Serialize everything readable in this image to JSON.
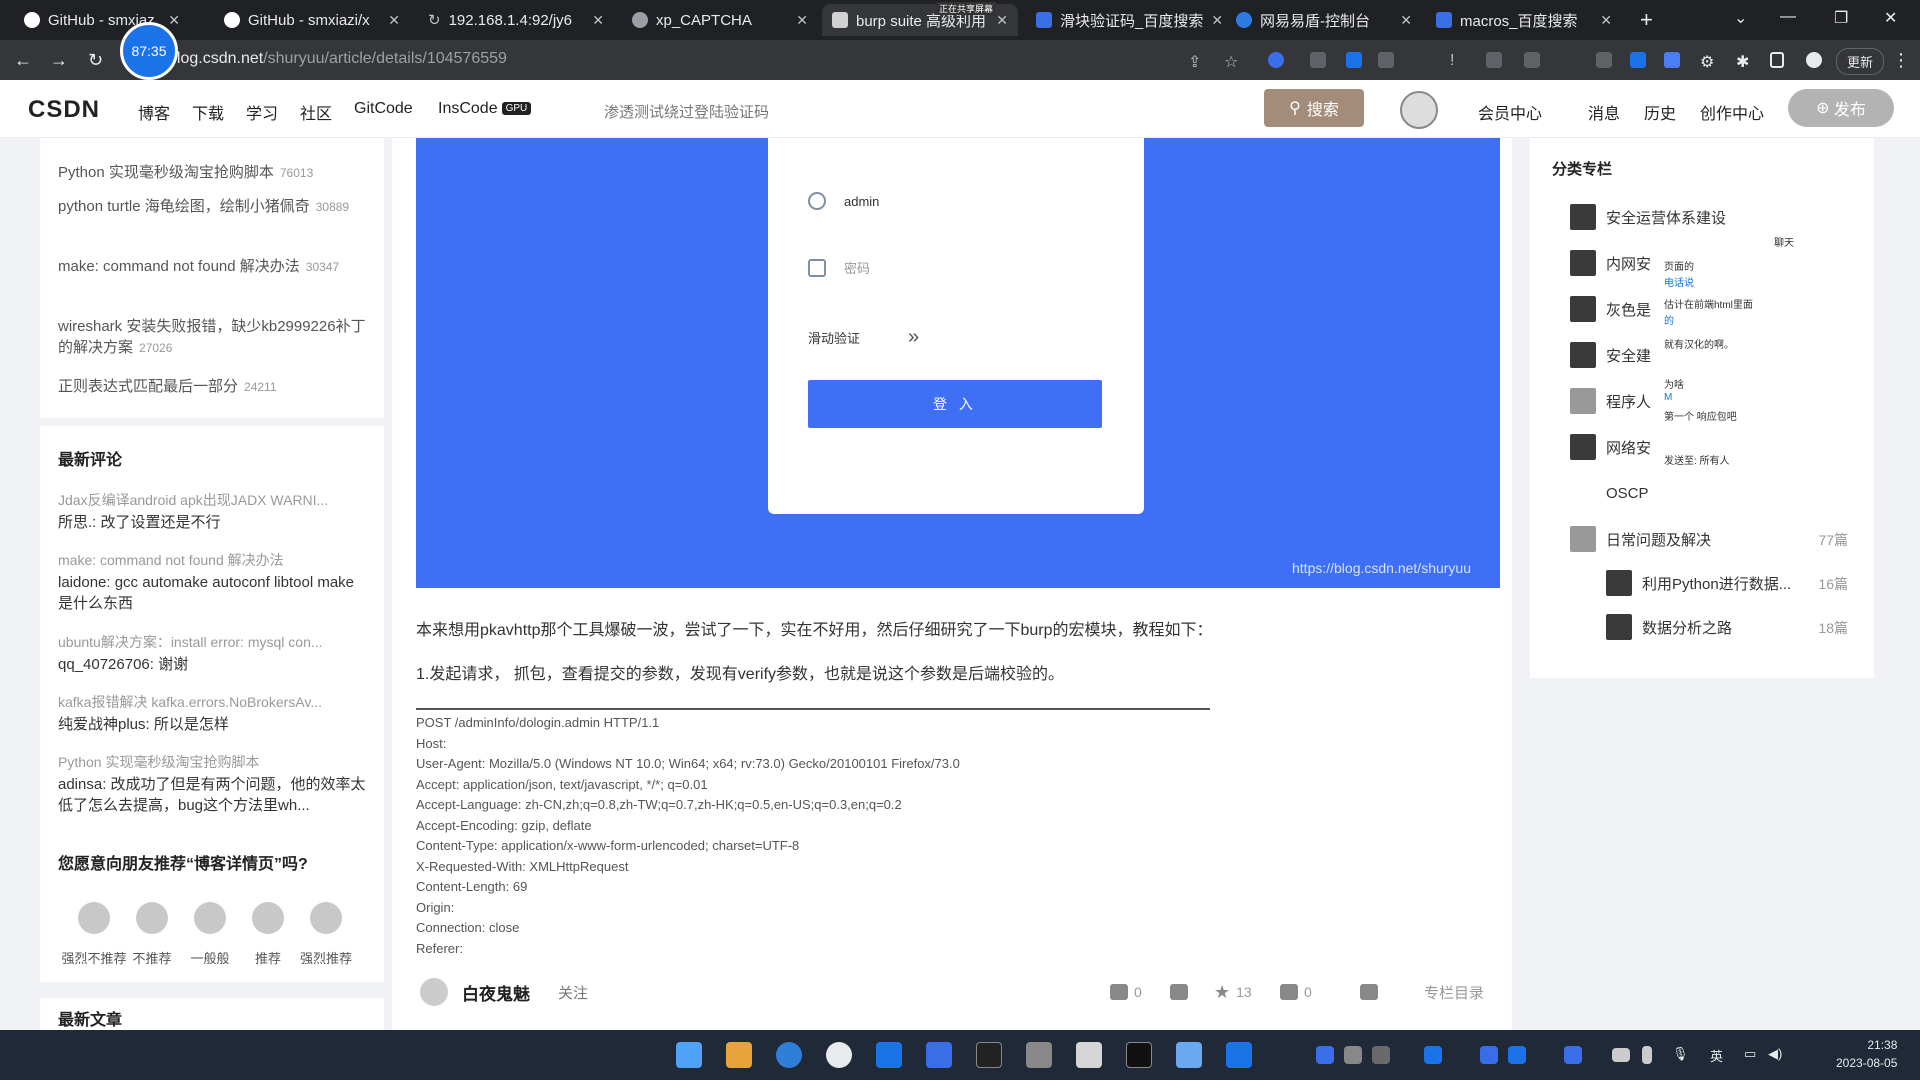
{
  "browser": {
    "tabs": [
      {
        "label": "GitHub - smxiaz"
      },
      {
        "label": "GitHub - smxiazi/x"
      },
      {
        "label": "192.168.1.4:92/jy6"
      },
      {
        "label": "xp_CAPTCHA"
      },
      {
        "label": "burp suite 高级利用"
      },
      {
        "label": "滑块验证码_百度搜索"
      },
      {
        "label": "网易易盾-控制台"
      },
      {
        "label": "macros_百度搜索"
      }
    ],
    "new_tab_label": "+",
    "url_host": "blog.csdn.net",
    "url_path": "/shuryuu/article/details/104576559",
    "update_label": "更新",
    "record_timer": "87:35",
    "share_notice": "正在共享屏幕"
  },
  "csdn_header": {
    "logo": "CSDN",
    "nav": [
      "博客",
      "下载",
      "学习",
      "社区",
      "GitCode",
      "InsCode"
    ],
    "gpu_badge": "GPU",
    "search_placeholder": "渗透测试绕过登陆验证码",
    "search_button": "搜索",
    "right_nav": [
      "会员中心",
      "消息",
      "历史",
      "创作中心"
    ],
    "publish_button": "发布"
  },
  "left_sidebar": {
    "hot_articles": [
      {
        "title": "Python 实现毫秒级淘宝抢购脚本",
        "count": "76013"
      },
      {
        "title": "python turtle 海龟绘图，绘制小猪佩奇",
        "count": "30889"
      },
      {
        "title": "make: command not found 解决办法",
        "count": "30347"
      },
      {
        "title": "wireshark 安装失败报错，缺少kb2999226补丁的解决方案",
        "count": "27026"
      },
      {
        "title": "正则表达式匹配最后一部分",
        "count": "24211"
      }
    ],
    "latest_comments_title": "最新评论",
    "latest_comments": [
      {
        "article": "Jdax反编译android apk出现JADX WARNI...",
        "comment": "所思.: 改了设置还是不行"
      },
      {
        "article": "make: command not found 解决办法",
        "comment": "laidone: gcc automake autoconf libtool make是什么东西"
      },
      {
        "article": "ubuntu解决方案：install error: mysql con...",
        "comment": "qq_40726706: 谢谢"
      },
      {
        "article": "kafka报错解决 kafka.errors.NoBrokersAv...",
        "comment": "纯爱战神plus: 所以是怎样"
      },
      {
        "article": "Python 实现毫秒级淘宝抢购脚本",
        "comment": "adinsa: 改成功了但是有两个问题，他的效率太低了怎么去提高，bug这个方法里wh..."
      }
    ],
    "recommend_title": "您愿意向朋友推荐“博客详情页”吗?",
    "ratings": [
      "强烈不推荐",
      "不推荐",
      "一般般",
      "推荐",
      "强烈推荐"
    ],
    "latest_articles_title": "最新文章"
  },
  "article": {
    "login_username": "admin",
    "login_password_placeholder": "密码",
    "slide_verify_label": "滑动验证",
    "slide_arrows": "»",
    "login_button": "登 入",
    "watermark": "https://blog.csdn.net/shuryuu",
    "paragraph1": "本来想用pkavhttp那个工具爆破一波，尝试了一下，实在不好用，然后仔细研究了一下burp的宏模块，教程如下：",
    "paragraph2": "1.发起请求， 抓包，查看提交的参数，发现有verify参数，也就是说这个参数是后端校验的。",
    "code_lines": [
      "POST          /adminInfo/dologin.admin HTTP/1.1",
      "Host:",
      "User-Agent: Mozilla/5.0 (Windows NT 10.0; Win64; x64; rv:73.0) Gecko/20100101 Firefox/73.0",
      "Accept: application/json, text/javascript, */*; q=0.01",
      "Accept-Language: zh-CN,zh;q=0.8,zh-TW;q=0.7,zh-HK;q=0.5,en-US;q=0.3,en;q=0.2",
      "Accept-Encoding: gzip, deflate",
      "Content-Type: application/x-www-form-urlencoded; charset=UTF-8",
      "X-Requested-With: XMLHttpRequest",
      "Content-Length: 69",
      "Origin:",
      "Connection: close",
      "Referer:"
    ],
    "footer": {
      "author": "白夜鬼魅",
      "follow": "关注",
      "likes": "0",
      "favorites": "13",
      "comments": "0",
      "column_toc": "专栏目录"
    }
  },
  "right_sidebar": {
    "title": "分类专栏",
    "items": [
      {
        "name": "安全运营体系建设",
        "count": ""
      },
      {
        "name": "内网安",
        "count": ""
      },
      {
        "name": "灰色是",
        "count": ""
      },
      {
        "name": "安全建",
        "count": ""
      },
      {
        "name": "程序人",
        "count": ""
      },
      {
        "name": "网络安",
        "count": ""
      },
      {
        "name": "OSCP",
        "count": ""
      },
      {
        "name": "日常问题及解决",
        "count": "77篇"
      },
      {
        "name": "利用Python进行数据...",
        "count": "16篇"
      },
      {
        "name": "数据分析之路",
        "count": "18篇"
      }
    ],
    "chat_lines": [
      "聊天",
      "页面的",
      "电话说",
      "估计在前端html里面",
      "的",
      "就有汉化的啊。",
      "为啥",
      "M",
      "第一个 响应包吧",
      "发送至: 所有人"
    ]
  },
  "taskbar": {
    "tray_lang": "英",
    "time": "21:38",
    "date": "2023-08-05"
  }
}
